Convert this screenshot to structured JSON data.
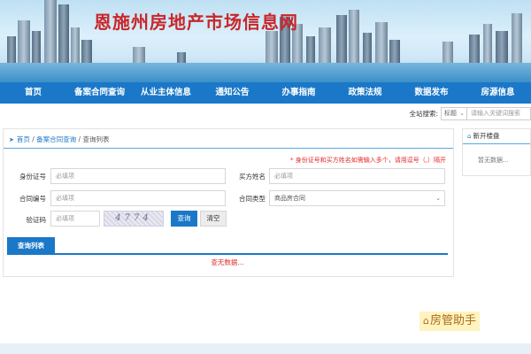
{
  "banner": {
    "title": "恩施州房地产市场信息网"
  },
  "nav": {
    "items": [
      "首页",
      "备案合同查询",
      "从业主体信息",
      "通知公告",
      "办事指南",
      "政策法规",
      "数据发布",
      "房源信息"
    ]
  },
  "site_search": {
    "label": "全站搜索:",
    "select_value": "标题",
    "placeholder": "请输入关键词搜索"
  },
  "breadcrumb": {
    "home": "首页",
    "sep": " / ",
    "section": "备案合同查询",
    "current": "查询列表"
  },
  "form": {
    "note": "* 身份证号和买方姓名如需输入多个，请用逗号（,）隔开",
    "id_label": "身份证号",
    "id_placeholder": "必填项",
    "buyer_label": "买方姓名",
    "buyer_placeholder": "必填项",
    "contract_no_label": "合同编号",
    "contract_no_placeholder": "必填项",
    "contract_type_label": "合同类型",
    "contract_type_value": "商品房合同",
    "captcha_label": "验证码",
    "captcha_placeholder": "必填项",
    "captcha_text": "4774",
    "query_button": "查询",
    "clear_button": "清空"
  },
  "results": {
    "tab": "查询列表",
    "empty": "查无数据..."
  },
  "side": {
    "title": "新开楼盘",
    "empty": "暂无数据..."
  },
  "watermark": {
    "text": "房管助手"
  },
  "colors": {
    "primary": "#1b78c8",
    "banner_title": "#c8262a",
    "alert": "#e02b2b"
  }
}
